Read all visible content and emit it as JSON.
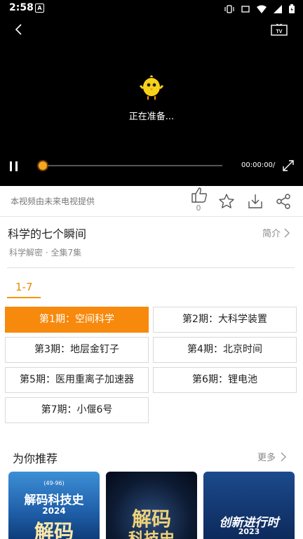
{
  "status_bar": {
    "time": "2:58",
    "notif_glyph": "A"
  },
  "player": {
    "loading_text": "正在准备...",
    "timecode": "00:00:00/",
    "progress_fraction": 0
  },
  "info": {
    "source": "本视频由未来电视提供",
    "like_count": "0"
  },
  "show": {
    "title": "科学的七个瞬间",
    "intro_label": "简介",
    "subtitle": "科学解密 · 全集7集"
  },
  "range_tab": "1-7",
  "episodes": [
    {
      "label": "第1期：空间科学",
      "active": true
    },
    {
      "label": "第2期：大科学装置",
      "active": false
    },
    {
      "label": "第3期：地层金钉子",
      "active": false
    },
    {
      "label": "第4期：北京时间",
      "active": false
    },
    {
      "label": "第5期：医用重离子加速器",
      "active": false
    },
    {
      "label": "第6期：锂电池",
      "active": false
    },
    {
      "label": "第7期：小偃6号",
      "active": false
    }
  ],
  "recommend": {
    "title": "为你推荐",
    "more": "更多",
    "posters": [
      {
        "small": "(49-96)",
        "big": "解码科技史",
        "year": "2024",
        "big2": "解码"
      },
      {
        "big": "解码",
        "big2": "科技史"
      },
      {
        "big": "创新进行时",
        "year": "2023"
      }
    ]
  },
  "colors": {
    "accent": "#f7890d",
    "player_bg": "#000000"
  }
}
